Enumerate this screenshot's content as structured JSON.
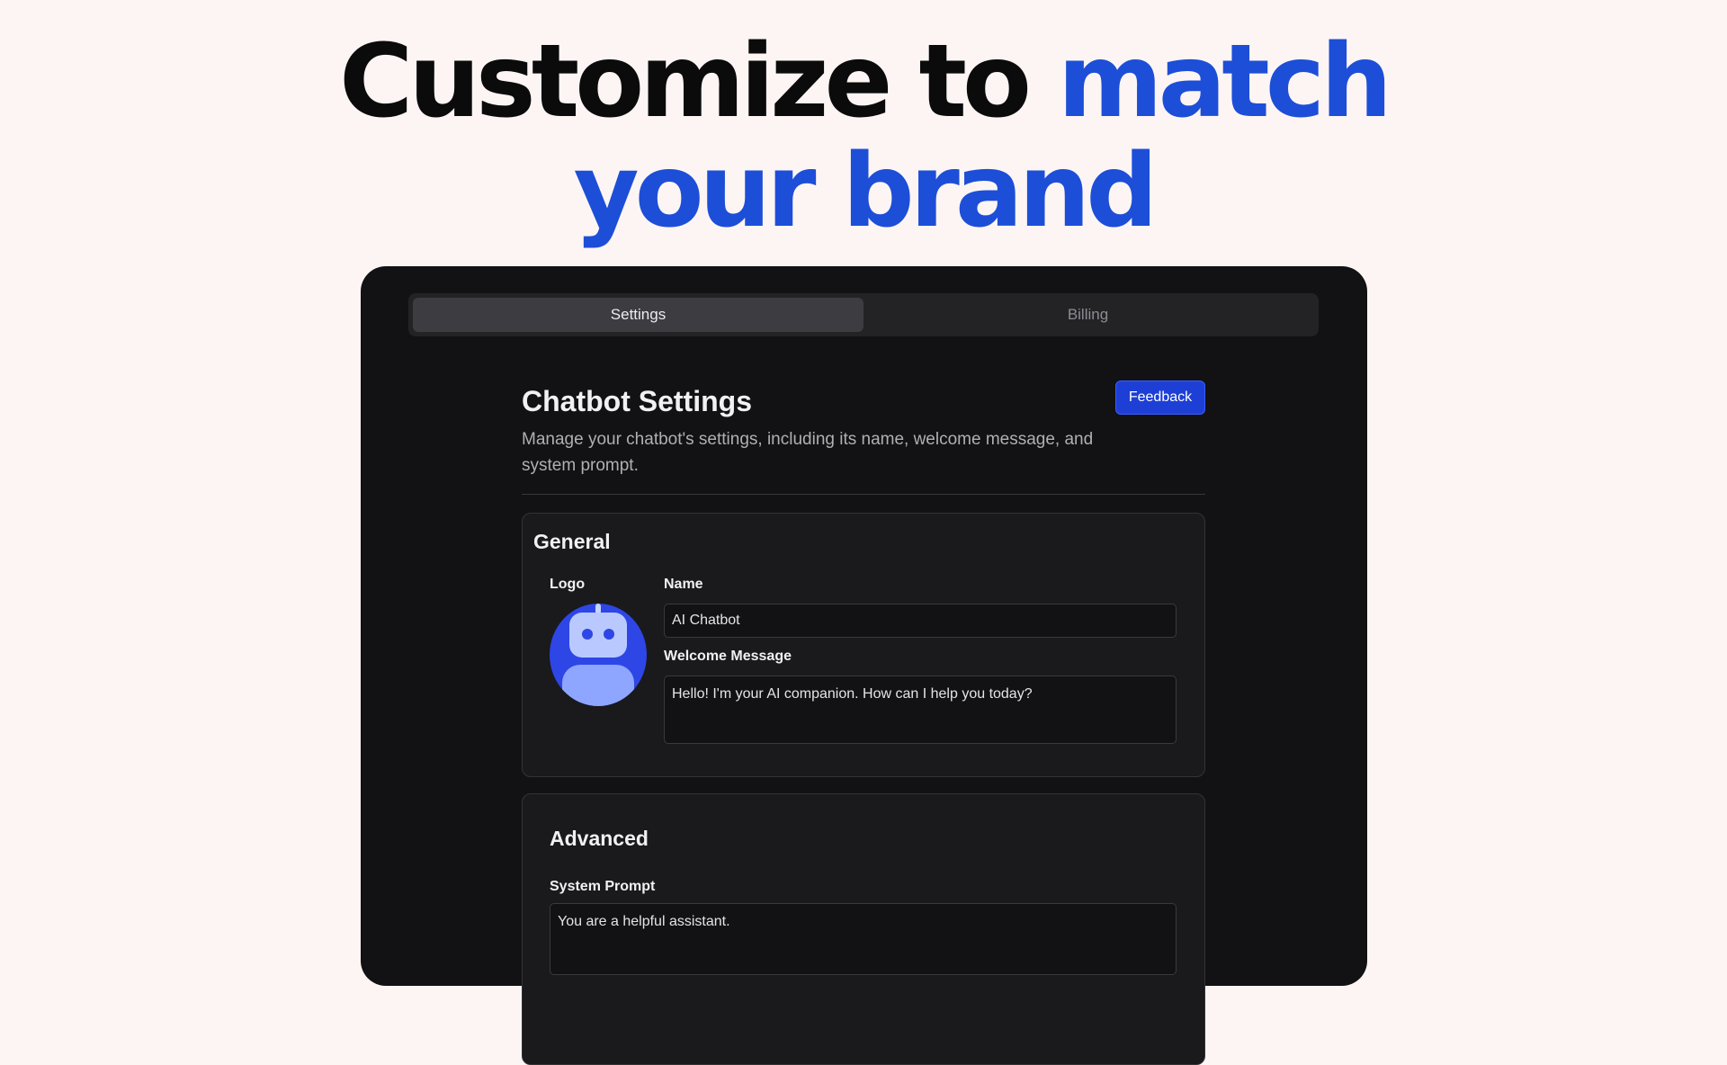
{
  "hero": {
    "line1_part1": "Customize to ",
    "line1_part2": "match",
    "line2": "your brand"
  },
  "tabs": [
    {
      "label": "Settings",
      "active": true
    },
    {
      "label": "Billing",
      "active": false
    }
  ],
  "page": {
    "title": "Chatbot Settings",
    "description": "Manage your chatbot's settings, including its name, welcome message, and system prompt.",
    "feedback_label": "Feedback"
  },
  "general": {
    "title": "General",
    "logo_label": "Logo",
    "name_label": "Name",
    "name_value": "AI Chatbot",
    "welcome_label": "Welcome Message",
    "welcome_value": "Hello! I'm your AI companion. How can I help you today?"
  },
  "advanced": {
    "title": "Advanced",
    "system_prompt_label": "System Prompt",
    "system_prompt_value": "You are a helpful assistant."
  },
  "colors": {
    "accent": "#1d4ed8",
    "background": "#fcf5f4",
    "panel": "#121113",
    "button": "#1d3fd6"
  },
  "icons": {
    "logo": "robot-avatar-icon"
  }
}
